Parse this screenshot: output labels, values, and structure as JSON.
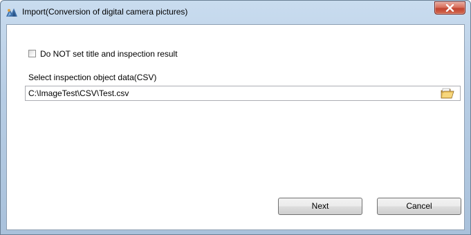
{
  "window": {
    "title": "Import(Conversion of digital camera pictures)",
    "icons": {
      "app": "app-logo-icon",
      "close": "close-icon"
    }
  },
  "form": {
    "checkbox_label": "Do NOT set title and inspection result",
    "checkbox_checked": false,
    "field_label": "Select inspection object data(CSV)",
    "path_value": "C:\\ImageTest\\CSV\\Test.csv",
    "browse_icon": "folder-open-icon"
  },
  "buttons": {
    "next": "Next",
    "cancel": "Cancel"
  },
  "colors": {
    "frame": "#b7cde4",
    "close_button": "#c24430"
  }
}
